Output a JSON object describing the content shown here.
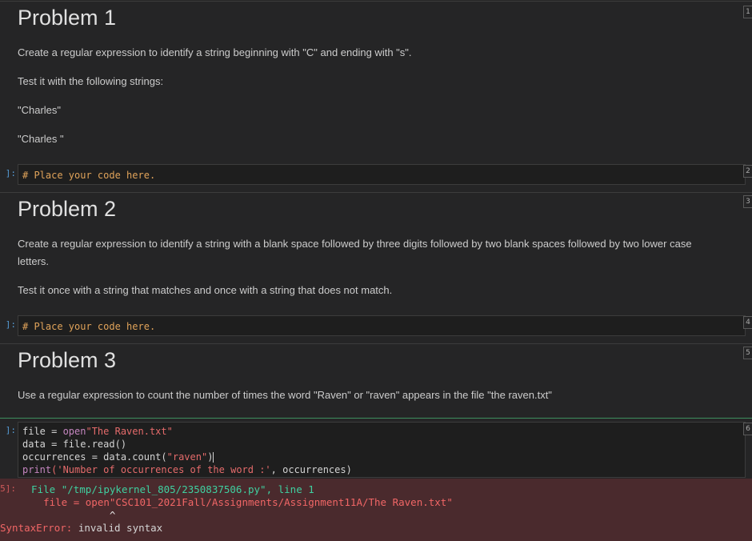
{
  "cells": {
    "c1": {
      "num": "1",
      "title": "Problem 1",
      "p1": "Create a regular expression to identify a string beginning with \"C\" and ending with \"s\".",
      "p2": "Test it with the following strings:",
      "p3": "\"Charles\"",
      "p4": "\"Charles \""
    },
    "c2": {
      "num": "2",
      "prompt": "]:",
      "code": "# Place your code here."
    },
    "c3": {
      "num": "3",
      "title": "Problem 2",
      "p1": "Create a regular expression to identify a string with a blank space followed by three digits followed by two blank spaces followed by two lower case",
      "p1b": "letters.",
      "p2": "Test it once with a string that matches and once with a string that does not match."
    },
    "c4": {
      "num": "4",
      "prompt": "]:",
      "code": "# Place your code here."
    },
    "c5": {
      "num": "5",
      "title": "Problem 3",
      "p1": "Use a regular expression to count the number of times the word \"Raven\" or \"raven\" appears in the file \"the raven.txt\""
    },
    "c6": {
      "num": "6",
      "prompt": "]:",
      "l1_a": "file = ",
      "l1_b": "open",
      "l1_c": "\"The Raven.txt\"",
      "l2": "data = file.read()",
      "l3_a": "occurrences = data.count(",
      "l3_b": "\"raven\"",
      "l3_c": ")",
      "l4_a": "print",
      "l4_b": "('Number of occurrences of the word :'",
      "l4_c": ", occurrences)"
    },
    "out": {
      "prompt": "5]:",
      "e1_a": "  File ",
      "e1_b": "\"/tmp/ipykernel_805/2350837506.py\"",
      "e1_c": ", line ",
      "e1_d": "1",
      "e2_a": "    file = open",
      "e2_b": "\"CSC101_2021Fall/Assignments/Assignment11A/The Raven.txt\"",
      "e3": "               ^",
      "e4_a": "SyntaxError:",
      "e4_b": " invalid syntax"
    }
  }
}
